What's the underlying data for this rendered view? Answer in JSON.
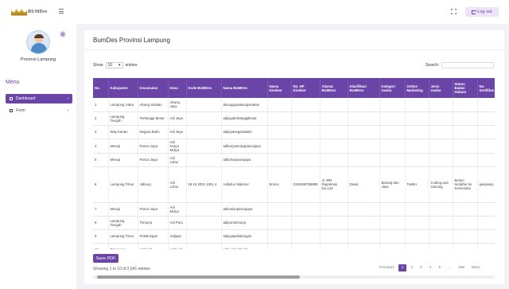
{
  "brand": {
    "name": "BUMDes"
  },
  "header": {
    "logout_label": "Log out"
  },
  "sidebar": {
    "user_name": "Provinsi Lampung",
    "menu_title": "Menu",
    "items": [
      {
        "label": "Dashboard"
      },
      {
        "label": "Form"
      }
    ]
  },
  "main": {
    "title": "BumDes Provinsi Lampung",
    "show_label": "Show",
    "entries_value": "10",
    "entries_label": "entries",
    "search_label": "Search:",
    "columns": [
      "No.",
      "Kabupaten",
      "Kecamatan",
      "Desa",
      "Kode BUMDes",
      "Nama BUMDes",
      "Nama Direktur",
      "No. HP Direktur",
      "Alamat BUMDes",
      "Klasifikasi BUMDes",
      "Kategori Usaha",
      "Online Marketing",
      "Jenis Usaha",
      "Status Badan Hukum",
      "No. Sertifikat"
    ],
    "rows": [
      [
        "1",
        "Lampung Utara",
        "Abung Selatan",
        "Abung Jaya",
        "",
        "abungjayaabungselatan",
        "",
        "",
        "",
        "",
        "",
        "",
        "",
        "",
        ""
      ],
      [
        "2",
        "Lampung Tengah",
        "Terbanggi Besar",
        "Adi Jaya",
        "",
        "adijayaterbanggibesar",
        "",
        "",
        "",
        "",
        "",
        "",
        "",
        "",
        ""
      ],
      [
        "3",
        "Way Kanan",
        "Negara Batin",
        "Adi Jaya",
        "",
        "adijayanegarabatin",
        "",
        "",
        "",
        "",
        "",
        "",
        "",
        "",
        ""
      ],
      [
        "4",
        "Mesuji",
        "Panca Jaya",
        "Adi Karya Mulya",
        "",
        "adikaryamulyapancajaya",
        "",
        "",
        "",
        "",
        "",
        "",
        "",
        "",
        ""
      ],
      [
        "5",
        "Mesuji",
        "Panca Jaya",
        "Adi Luhur",
        "",
        "adiluhurpancajaya",
        "",
        "",
        "",
        "",
        "",
        "",
        "",
        "",
        ""
      ],
      [
        "6",
        "Lampung Timur",
        "Jabung",
        "Adi Luhur",
        "18.10.2001.1001.4",
        "Adiluhur Makmur",
        "Enrico",
        "0160488768889",
        "Jl. WR Rapatman No.143",
        "Dasar",
        "Barang dan Jasa",
        "Twitter",
        "Coding and Gaming",
        "Belum terdaftar ke Kemendes",
        "qwepwep"
      ],
      [
        "7",
        "Mesuji",
        "Panca Jaya",
        "Adi Mulyo",
        "",
        "adimulyopancajaya",
        "",
        "",
        "",
        "",
        "",
        "",
        "",
        "",
        ""
      ],
      [
        "8",
        "Lampung Tengah",
        "Trimurjo",
        "Adi Puro",
        "",
        "adipurotrimurjo",
        "",
        "",
        "",
        "",
        "",
        "",
        "",
        "",
        ""
      ],
      [
        "9",
        "Lampung Timur",
        "Pekalongan",
        "Adijaya",
        "",
        "adijayapekalongan",
        "",
        "",
        "",
        "",
        "",
        "",
        "",
        "",
        ""
      ],
      [
        "10",
        "Pringsewu",
        "Adiluwih",
        "Adiluwih",
        "",
        "adiluwihadiluwih",
        "",
        "",
        "",
        "",
        "",
        "",
        "",
        "",
        ""
      ]
    ],
    "save_pdf_label": "Save PDF",
    "info": "Showing 1 to 10 of 2,641 entries",
    "pagination": {
      "previous": "Previous",
      "pages": [
        "1",
        "2",
        "3",
        "4",
        "5",
        "...",
        "265"
      ],
      "current": "1",
      "next": "Next"
    }
  },
  "colors": {
    "accent": "#6b44a8",
    "background": "#f2f3f7"
  }
}
